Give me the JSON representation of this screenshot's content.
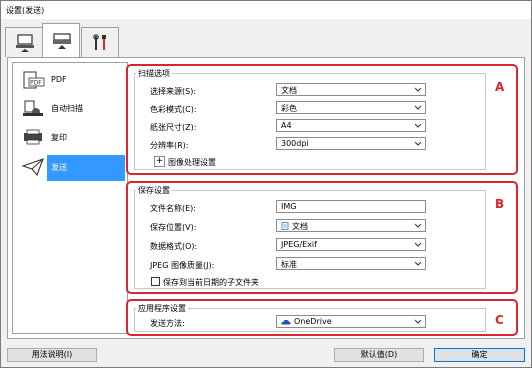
{
  "window": {
    "title": "设置(发送)"
  },
  "tabs": [
    {
      "icon": "computer-scan-icon"
    },
    {
      "icon": "device-scan-icon"
    },
    {
      "icon": "tools-icon"
    }
  ],
  "sidebar": {
    "items": [
      {
        "label": "PDF",
        "icon": "pdf-icon"
      },
      {
        "label": "自动扫描",
        "icon": "auto-scan-icon"
      },
      {
        "label": "复印",
        "icon": "copy-icon"
      },
      {
        "label": "发送",
        "icon": "send-icon",
        "selected": true
      }
    ]
  },
  "scan_options": {
    "title": "扫描选项",
    "badge": "A",
    "source_label": "选择来源(S):",
    "source_value": "文档",
    "color_label": "色彩模式(C):",
    "color_value": "彩色",
    "paper_label": "纸张尺寸(Z):",
    "paper_value": "A4",
    "resolution_label": "分辨率(R):",
    "resolution_value": "300dpi",
    "image_processing_label": "图像处理设置",
    "expand_symbol": "+"
  },
  "save_settings": {
    "title": "保存设置",
    "badge": "B",
    "filename_label": "文件名称(E):",
    "filename_value": "IMG",
    "location_label": "保存位置(V):",
    "location_value": "文档",
    "format_label": "数据格式(O):",
    "format_value": "JPEG/Exif",
    "quality_label": "JPEG 图像质量(J):",
    "quality_value": "标准",
    "subfolder_label": "保存到当前日期的子文件夹",
    "subfolder_checked": false
  },
  "app_settings": {
    "title": "应用程序设置",
    "badge": "C",
    "send_label": "发送方法:",
    "send_value": "OneDrive",
    "send_icon": "onedrive-cloud-icon"
  },
  "footer": {
    "help_label": "用法说明(I)",
    "defaults_label": "默认值(D)",
    "ok_label": "确定"
  },
  "colors": {
    "highlight": "#d7262e",
    "selection": "#3399ff"
  }
}
